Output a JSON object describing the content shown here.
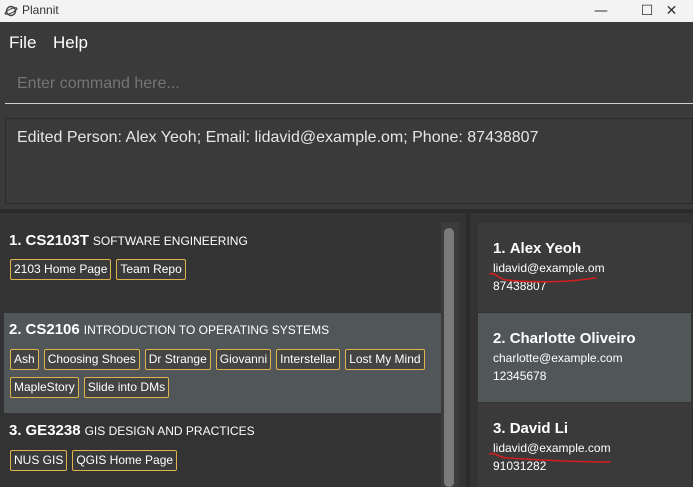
{
  "window": {
    "title": "Plannit",
    "minimize_glyph": "—",
    "maximize_glyph": "☐",
    "close_glyph": "✕",
    "icon": "planet-icon"
  },
  "menu": {
    "file": "File",
    "help": "Help"
  },
  "command": {
    "placeholder": "Enter command here..."
  },
  "result": {
    "text": "Edited Person: Alex Yeoh; Email: lidavid@example.om; Phone: 87438807"
  },
  "modules": [
    {
      "index": "1.",
      "code": "CS2103T",
      "name": "SOFTWARE ENGINEERING",
      "tags": [
        "2103 Home Page",
        "Team Repo"
      ]
    },
    {
      "index": "2.",
      "code": "CS2106",
      "name": "INTRODUCTION TO OPERATING SYSTEMS",
      "tags": [
        "Ash",
        "Choosing Shoes",
        "Dr Strange",
        "Giovanni",
        "Interstellar",
        "Lost My Mind",
        "MapleStory",
        "Slide into DMs"
      ]
    },
    {
      "index": "3.",
      "code": "GE3238",
      "name": "GIS DESIGN AND PRACTICES",
      "tags": [
        "NUS GIS",
        "QGIS Home Page"
      ]
    }
  ],
  "persons": [
    {
      "index": "1.",
      "name": "Alex Yeoh",
      "email": "lidavid@example.om",
      "phone": "87438807"
    },
    {
      "index": "2.",
      "name": "Charlotte Oliveiro",
      "email": "charlotte@example.com",
      "phone": "12345678"
    },
    {
      "index": "3.",
      "name": "David Li",
      "email": "lidavid@example.com",
      "phone": "91031282"
    }
  ],
  "colors": {
    "background": "#3a3a3a",
    "panel": "#333333",
    "selected_row": "#515658",
    "tag_border": "#e0b44d",
    "annotation_red": "#d21e1e"
  }
}
